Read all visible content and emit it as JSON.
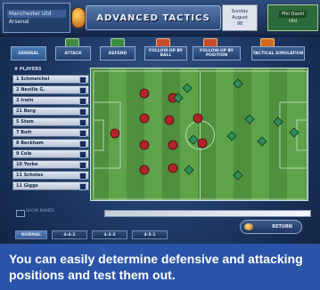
{
  "header": {
    "home_team": "Manchester Utd",
    "away_team": "Arsenal",
    "title": "ADVANCED TACTICS",
    "date_line1": "Sunday",
    "date_line2": "August",
    "date_line3": "98",
    "manager_name": "Phil Doohl",
    "club_label": "Utd"
  },
  "tabs": [
    {
      "label": "GENERAL"
    },
    {
      "label": "ATTACK"
    },
    {
      "label": "DEFEND"
    },
    {
      "label": "FOLLOW-UP BY BALL"
    },
    {
      "label": "FOLLOW-UP BY POSITION"
    },
    {
      "label": "TACTICAL SIMULATION"
    }
  ],
  "players_header": "# PLAYERS",
  "players": [
    {
      "label": "1  Schmeichel"
    },
    {
      "label": "2  Neville G."
    },
    {
      "label": "3  Irwin"
    },
    {
      "label": "21 Berg"
    },
    {
      "label": "5  Stam"
    },
    {
      "label": "7  Butt"
    },
    {
      "label": "8  Beckham"
    },
    {
      "label": "9  Cole"
    },
    {
      "label": "10 Yorke"
    },
    {
      "label": "11 Scholes"
    },
    {
      "label": "11 Giggs"
    }
  ],
  "colors": {
    "home": "#b0242a",
    "away": "#2f8f58",
    "pitch_light": "#5ea34a",
    "pitch_dark": "#4f8f3e"
  },
  "checkbox_label": "SHOW NAMES",
  "return_label": "RETURN",
  "mode_tabs": [
    {
      "label": "NORMAL"
    },
    {
      "label": "4-4-2"
    },
    {
      "label": "4-3-3"
    },
    {
      "label": "4-5-1"
    }
  ],
  "caption": "You can easily determine defensive and attacking positions and test them out."
}
